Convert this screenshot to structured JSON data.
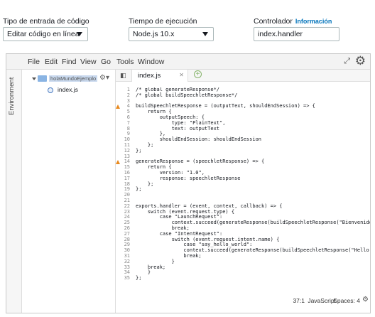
{
  "fields": {
    "code_entry": {
      "label": "Tipo de entrada de código",
      "value": "Editar código en línea"
    },
    "runtime": {
      "label": "Tiempo de ejecución",
      "value": "Node.js 10.x"
    },
    "handler": {
      "label": "Controlador",
      "info": "Información",
      "value": "index.handler"
    }
  },
  "ide": {
    "menu": [
      "File",
      "Edit",
      "Find",
      "View",
      "Go",
      "Tools",
      "Window"
    ],
    "icons": {
      "fullscreen": "fullscreen-icon",
      "settings": "gear-icon"
    },
    "environment_label": "Environment",
    "tree": {
      "root_label": "holaMundoEjemplo",
      "files": [
        "index.js"
      ]
    },
    "tab": {
      "label": "index.js"
    },
    "code": [
      {
        "n": "1",
        "text": "/* global generateResponse*/"
      },
      {
        "n": "2",
        "text": "/* global buildSpeechletResponse*/"
      },
      {
        "n": "3",
        "text": ""
      },
      {
        "n": "4",
        "text": "buildSpeechletResponse = (outputText, shouldEndSession) => {",
        "warn": true
      },
      {
        "n": "5",
        "text": "    return {"
      },
      {
        "n": "6",
        "text": "        outputSpeech: {"
      },
      {
        "n": "7",
        "text": "            type: \"PlainText\","
      },
      {
        "n": "8",
        "text": "            text: outputText"
      },
      {
        "n": "9",
        "text": "        },"
      },
      {
        "n": "10",
        "text": "        shouldEndSession: shouldEndSession"
      },
      {
        "n": "11",
        "text": "    };"
      },
      {
        "n": "12",
        "text": "};"
      },
      {
        "n": "13",
        "text": ""
      },
      {
        "n": "14",
        "text": "generateResponse = (speechletResponse) => {",
        "warn": true
      },
      {
        "n": "15",
        "text": "    return {"
      },
      {
        "n": "16",
        "text": "        version: \"1.0\","
      },
      {
        "n": "17",
        "text": "        response: speechletResponse"
      },
      {
        "n": "18",
        "text": "    };"
      },
      {
        "n": "19",
        "text": "};"
      },
      {
        "n": "20",
        "text": ""
      },
      {
        "n": "21",
        "text": ""
      },
      {
        "n": "22",
        "text": "exports.handler = (event, context, callback) => {"
      },
      {
        "n": "23",
        "text": "    switch (event.request.type) {"
      },
      {
        "n": "24",
        "text": "        case \"LaunchRequest\":"
      },
      {
        "n": "25",
        "text": "            context.succeed(generateResponse(buildSpeechletResponse(\"Bienvenido"
      },
      {
        "n": "26",
        "text": "            break;"
      },
      {
        "n": "27",
        "text": "        case \"IntentRequest\":"
      },
      {
        "n": "28",
        "text": "            switch (event.request.intent.name) {"
      },
      {
        "n": "29",
        "text": "                case \"say_hello_world\":"
      },
      {
        "n": "30",
        "text": "                context.succeed(generateResponse(buildSpeechletResponse(\"Hello"
      },
      {
        "n": "31",
        "text": "                break;"
      },
      {
        "n": "32",
        "text": "            }"
      },
      {
        "n": "33",
        "text": "    break;"
      },
      {
        "n": "34",
        "text": "    }"
      },
      {
        "n": "35",
        "text": "};"
      }
    ],
    "status": {
      "position": "37:1",
      "language": "JavaScript",
      "spaces": "Spaces: 4"
    }
  }
}
